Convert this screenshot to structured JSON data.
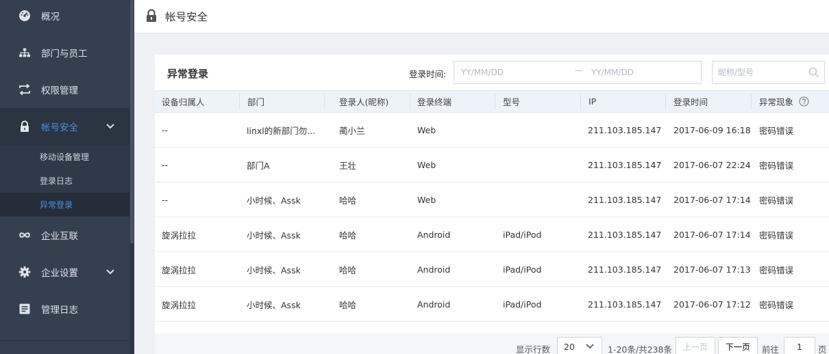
{
  "sidebar": {
    "items": [
      {
        "label": "概况",
        "icon": "dashboard-icon"
      },
      {
        "label": "部门与员工",
        "icon": "org-tree-icon"
      },
      {
        "label": "权限管理",
        "icon": "swap-icon"
      },
      {
        "label": "帐号安全",
        "icon": "lock-icon",
        "active": true
      },
      {
        "label": "企业互联",
        "icon": "infinity-icon"
      },
      {
        "label": "企业设置",
        "icon": "gear-icon"
      },
      {
        "label": "管理日志",
        "icon": "log-icon"
      }
    ],
    "sub_items": [
      {
        "label": "移动设备管理"
      },
      {
        "label": "登录日志"
      },
      {
        "label": "异常登录",
        "active": true
      }
    ]
  },
  "header": {
    "title": "帐号安全"
  },
  "card": {
    "title": "异常登录",
    "filter_label": "登录时间:",
    "date_start_placeholder": "YY/MM/DD",
    "date_sep": "—",
    "date_end_placeholder": "YY/MM/DD",
    "search_placeholder": "昵称/型号"
  },
  "table": {
    "columns": [
      "设备归属人",
      "部门",
      "登录人(昵称)",
      "登录终端",
      "型号",
      "IP",
      "登录时间",
      "异常现象"
    ],
    "rows": [
      [
        "--",
        "linxl的新部门勿...",
        "蔺小兰",
        "Web",
        "",
        "211.103.185.147",
        "2017-06-09 16:18",
        "密码错误"
      ],
      [
        "--",
        "部门A",
        "王壮",
        "Web",
        "",
        "211.103.185.147",
        "2017-06-07 22:24",
        "密码错误"
      ],
      [
        "--",
        "小时候、Assk",
        "哈哈",
        "Web",
        "",
        "211.103.185.147",
        "2017-06-07 17:14",
        "密码错误"
      ],
      [
        "旋涡拉拉",
        "小时候、Assk",
        "哈哈",
        "Android",
        "iPad/iPod",
        "211.103.185.147",
        "2017-06-07 17:14",
        "密码错误"
      ],
      [
        "旋涡拉拉",
        "小时候、Assk",
        "哈哈",
        "Android",
        "iPad/iPod",
        "211.103.185.147",
        "2017-06-07 17:13",
        "密码错误"
      ],
      [
        "旋涡拉拉",
        "小时候、Assk",
        "哈哈",
        "Android",
        "iPad/iPod",
        "211.103.185.147",
        "2017-06-07 17:12",
        "密码错误"
      ]
    ]
  },
  "pagination": {
    "rows_label": "显示行数",
    "rows_value": "20",
    "range_text": "1-20条/共238条",
    "prev_label": "上一页",
    "next_label": "下一页",
    "goto_label": "前往",
    "page_value": "1",
    "page_suffix": "页"
  },
  "colors": {
    "sidebar_bg": "#35404f",
    "accent": "#4a90e2",
    "table_header_bg": "#eef3f9"
  }
}
